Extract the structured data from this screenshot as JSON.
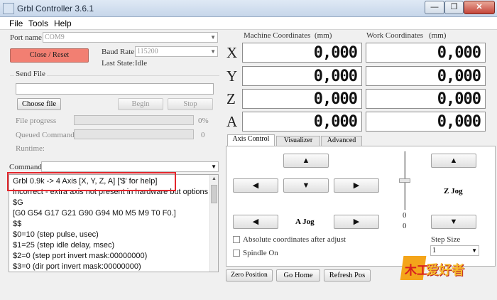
{
  "window": {
    "title": "Grbl Controller 3.6.1",
    "minimize": "—",
    "restore": "❐",
    "close": "✕"
  },
  "menu": [
    "File",
    "Tools",
    "Help"
  ],
  "connection": {
    "port_label": "Port name",
    "port_value": "COM9",
    "close_reset": "Close / Reset",
    "baud_label": "Baud Rate",
    "baud_value": "115200",
    "last_state_label": "Last State:",
    "last_state_value": "Idle"
  },
  "send_file": {
    "label": "Send File",
    "file_value": "",
    "choose_file": "Choose file",
    "begin": "Begin",
    "stop": "Stop",
    "file_progress_label": "File progress",
    "file_progress_percent": "0%",
    "file_progress_value": 0,
    "queued_label": "Queued Commands",
    "queued_value": "0",
    "queued_progress": 0,
    "runtime_label": "Runtime:"
  },
  "command": {
    "label": "Command",
    "value": ""
  },
  "console": [
    "Grbl 0.9k -> 4 Axis [X, Y, Z, A] ['$' for help]",
    "Incorrect - extra axis not present in hardware but options",
    "$G",
    "[G0 G54 G17 G21 G90 G94 M0 M5 M9 T0 F0.]",
    "$$",
    "$0=10 (step pulse, usec)",
    "$1=25 (step idle delay, msec)",
    "$2=0 (step port invert mask:00000000)",
    "$3=0 (dir port invert mask:00000000)"
  ],
  "coords": {
    "machine_label": "Machine Coordinates",
    "machine_unit": "(mm)",
    "work_label": "Work Coordinates",
    "work_unit": "(mm)",
    "axes": [
      {
        "name": "X",
        "machine": "0,000",
        "work": "0,000"
      },
      {
        "name": "Y",
        "machine": "0,000",
        "work": "0,000"
      },
      {
        "name": "Z",
        "machine": "0,000",
        "work": "0,000"
      },
      {
        "name": "A",
        "machine": "0,000",
        "work": "0,000"
      }
    ]
  },
  "tabs": [
    "Axis Control",
    "Visualizer",
    "Advanced"
  ],
  "axis_control": {
    "a_jog": "A Jog",
    "z_jog": "Z Jog",
    "slider_value_1": "0",
    "slider_value_2": "0",
    "absolute_coords": "Absolute coordinates after adjust",
    "spindle_on": "Spindle On",
    "step_size_label": "Step Size",
    "step_size_value": "1",
    "arrows": {
      "up": "▲",
      "down": "▼",
      "left": "◀",
      "right": "▶"
    }
  },
  "bottom_buttons": {
    "zero_position": "Zero Position",
    "go_home": "Go Home",
    "refresh_pos": "Refresh Pos"
  },
  "watermark": {
    "box": "木工",
    "main": "爱好者",
    "sub": "​"
  }
}
